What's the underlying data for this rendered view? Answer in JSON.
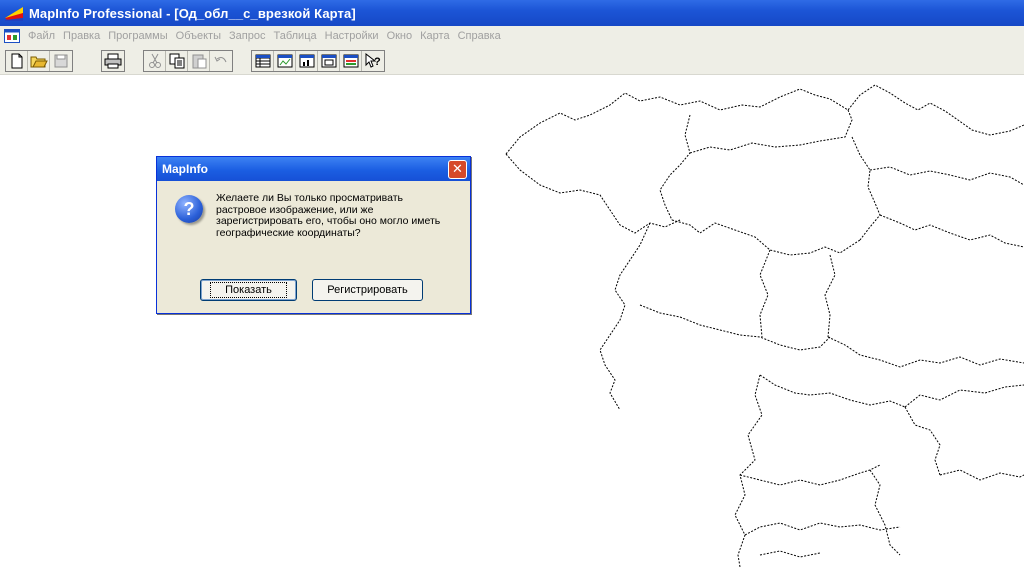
{
  "window": {
    "title": "MapInfo Professional - [Од_обл__с_врезкой Карта]"
  },
  "menu": {
    "items": [
      "Файл",
      "Правка",
      "Программы",
      "Объекты",
      "Запрос",
      "Таблица",
      "Настройки",
      "Окно",
      "Карта",
      "Справка"
    ]
  },
  "toolbar": {
    "groups": [
      [
        "new-icon",
        "open-icon",
        "save-icon"
      ],
      [
        "print-icon"
      ],
      [
        "cut-icon",
        "copy-icon",
        "paste-icon",
        "undo-icon"
      ],
      [
        "new-browser-icon",
        "new-mapper-icon",
        "new-grapher-icon",
        "new-layout-icon",
        "new-redistrict-icon",
        "help-pointer-icon"
      ]
    ]
  },
  "dialog": {
    "title": "MapInfo",
    "icon": "question-icon",
    "message": "Желаете ли Вы только просматривать растровое изображение, или же зарегистрировать его, чтобы оно могло иметь географические координаты?",
    "buttons": {
      "show": "Показать",
      "register": "Регистрировать"
    }
  },
  "colors": {
    "titlebar": "#1c55d6",
    "chrome": "#eeeee6",
    "dialog_bg": "#ece9d8",
    "close_button": "#d64a2a"
  }
}
